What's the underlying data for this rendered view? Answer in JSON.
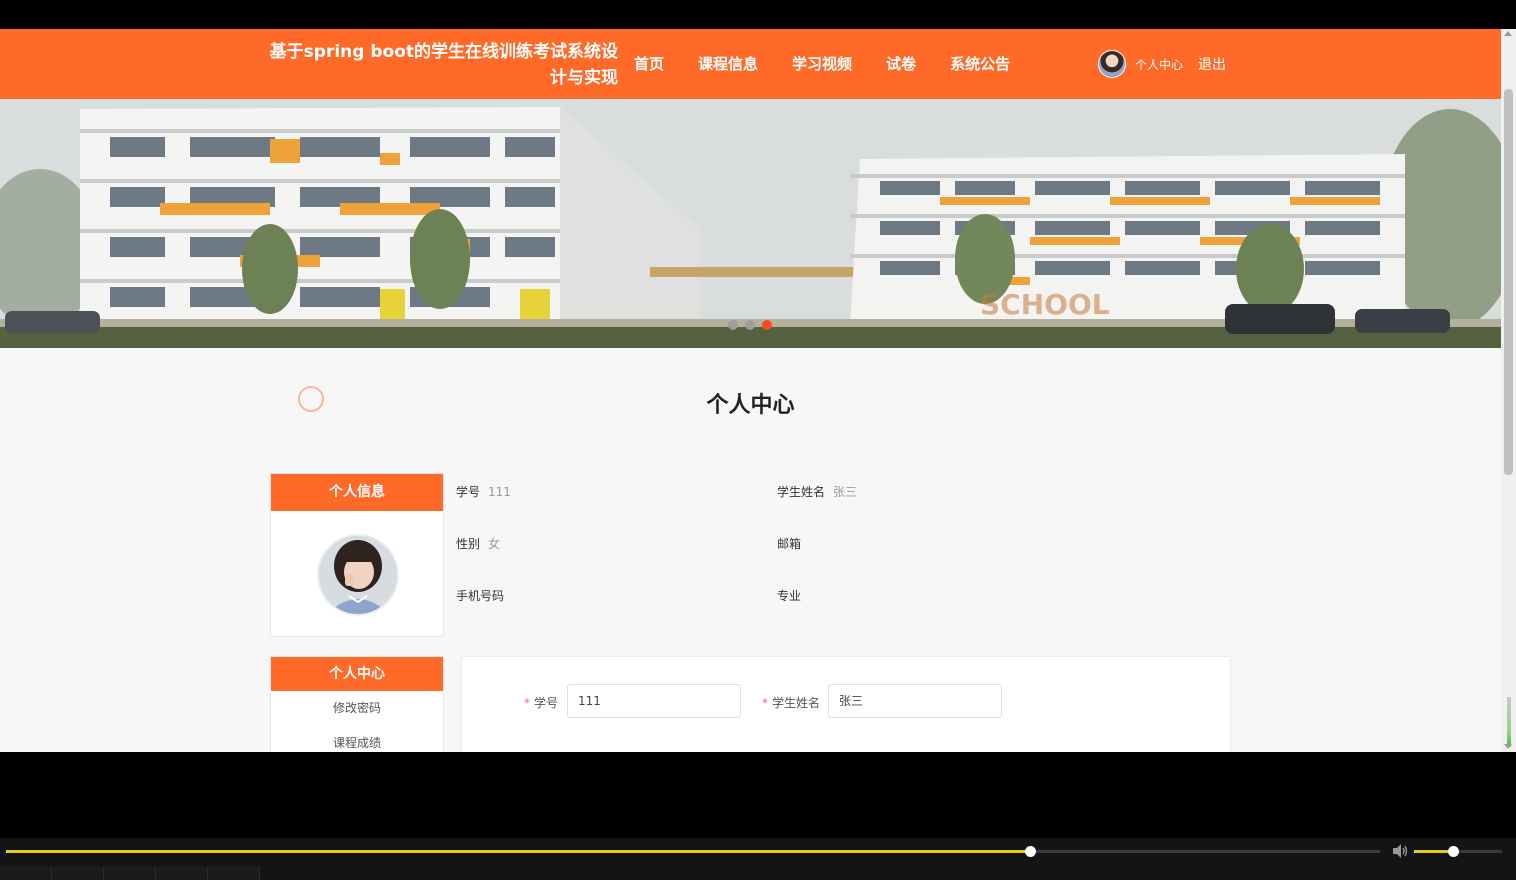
{
  "header": {
    "site_title_line1": "基于spring boot的学生在线训练考试系统设",
    "site_title_line2": "计与实现",
    "nav": [
      {
        "label": "首页"
      },
      {
        "label": "课程信息"
      },
      {
        "label": "学习视频"
      },
      {
        "label": "试卷"
      },
      {
        "label": "系统公告"
      }
    ],
    "user_center": "个人中心",
    "logout": "退出"
  },
  "banner": {
    "dots": 3,
    "active_dot": 3,
    "watermark": "SCHOOL"
  },
  "page_title": "个人中心",
  "info_card": {
    "title": "个人信息"
  },
  "info_fields": [
    {
      "label": "学号",
      "value": "111"
    },
    {
      "label": "学生姓名",
      "value": "张三"
    },
    {
      "label": "性别",
      "value": "女"
    },
    {
      "label": "邮箱",
      "value": ""
    },
    {
      "label": "手机号码",
      "value": ""
    },
    {
      "label": "专业",
      "value": ""
    }
  ],
  "menu_card": {
    "title": "个人中心",
    "items": [
      {
        "label": "修改密码"
      },
      {
        "label": "课程成绩"
      }
    ]
  },
  "form": {
    "student_id_label": "学号",
    "student_id_value": "111",
    "student_name_label": "学生姓名",
    "student_name_value": "张三",
    "required_mark": "*"
  },
  "player": {
    "progress_fraction": 0.745,
    "volume_fraction": 0.44,
    "accent_color": "#e8c91a"
  },
  "colors": {
    "brand": "#ff6a28",
    "required": "#f56c6c"
  }
}
